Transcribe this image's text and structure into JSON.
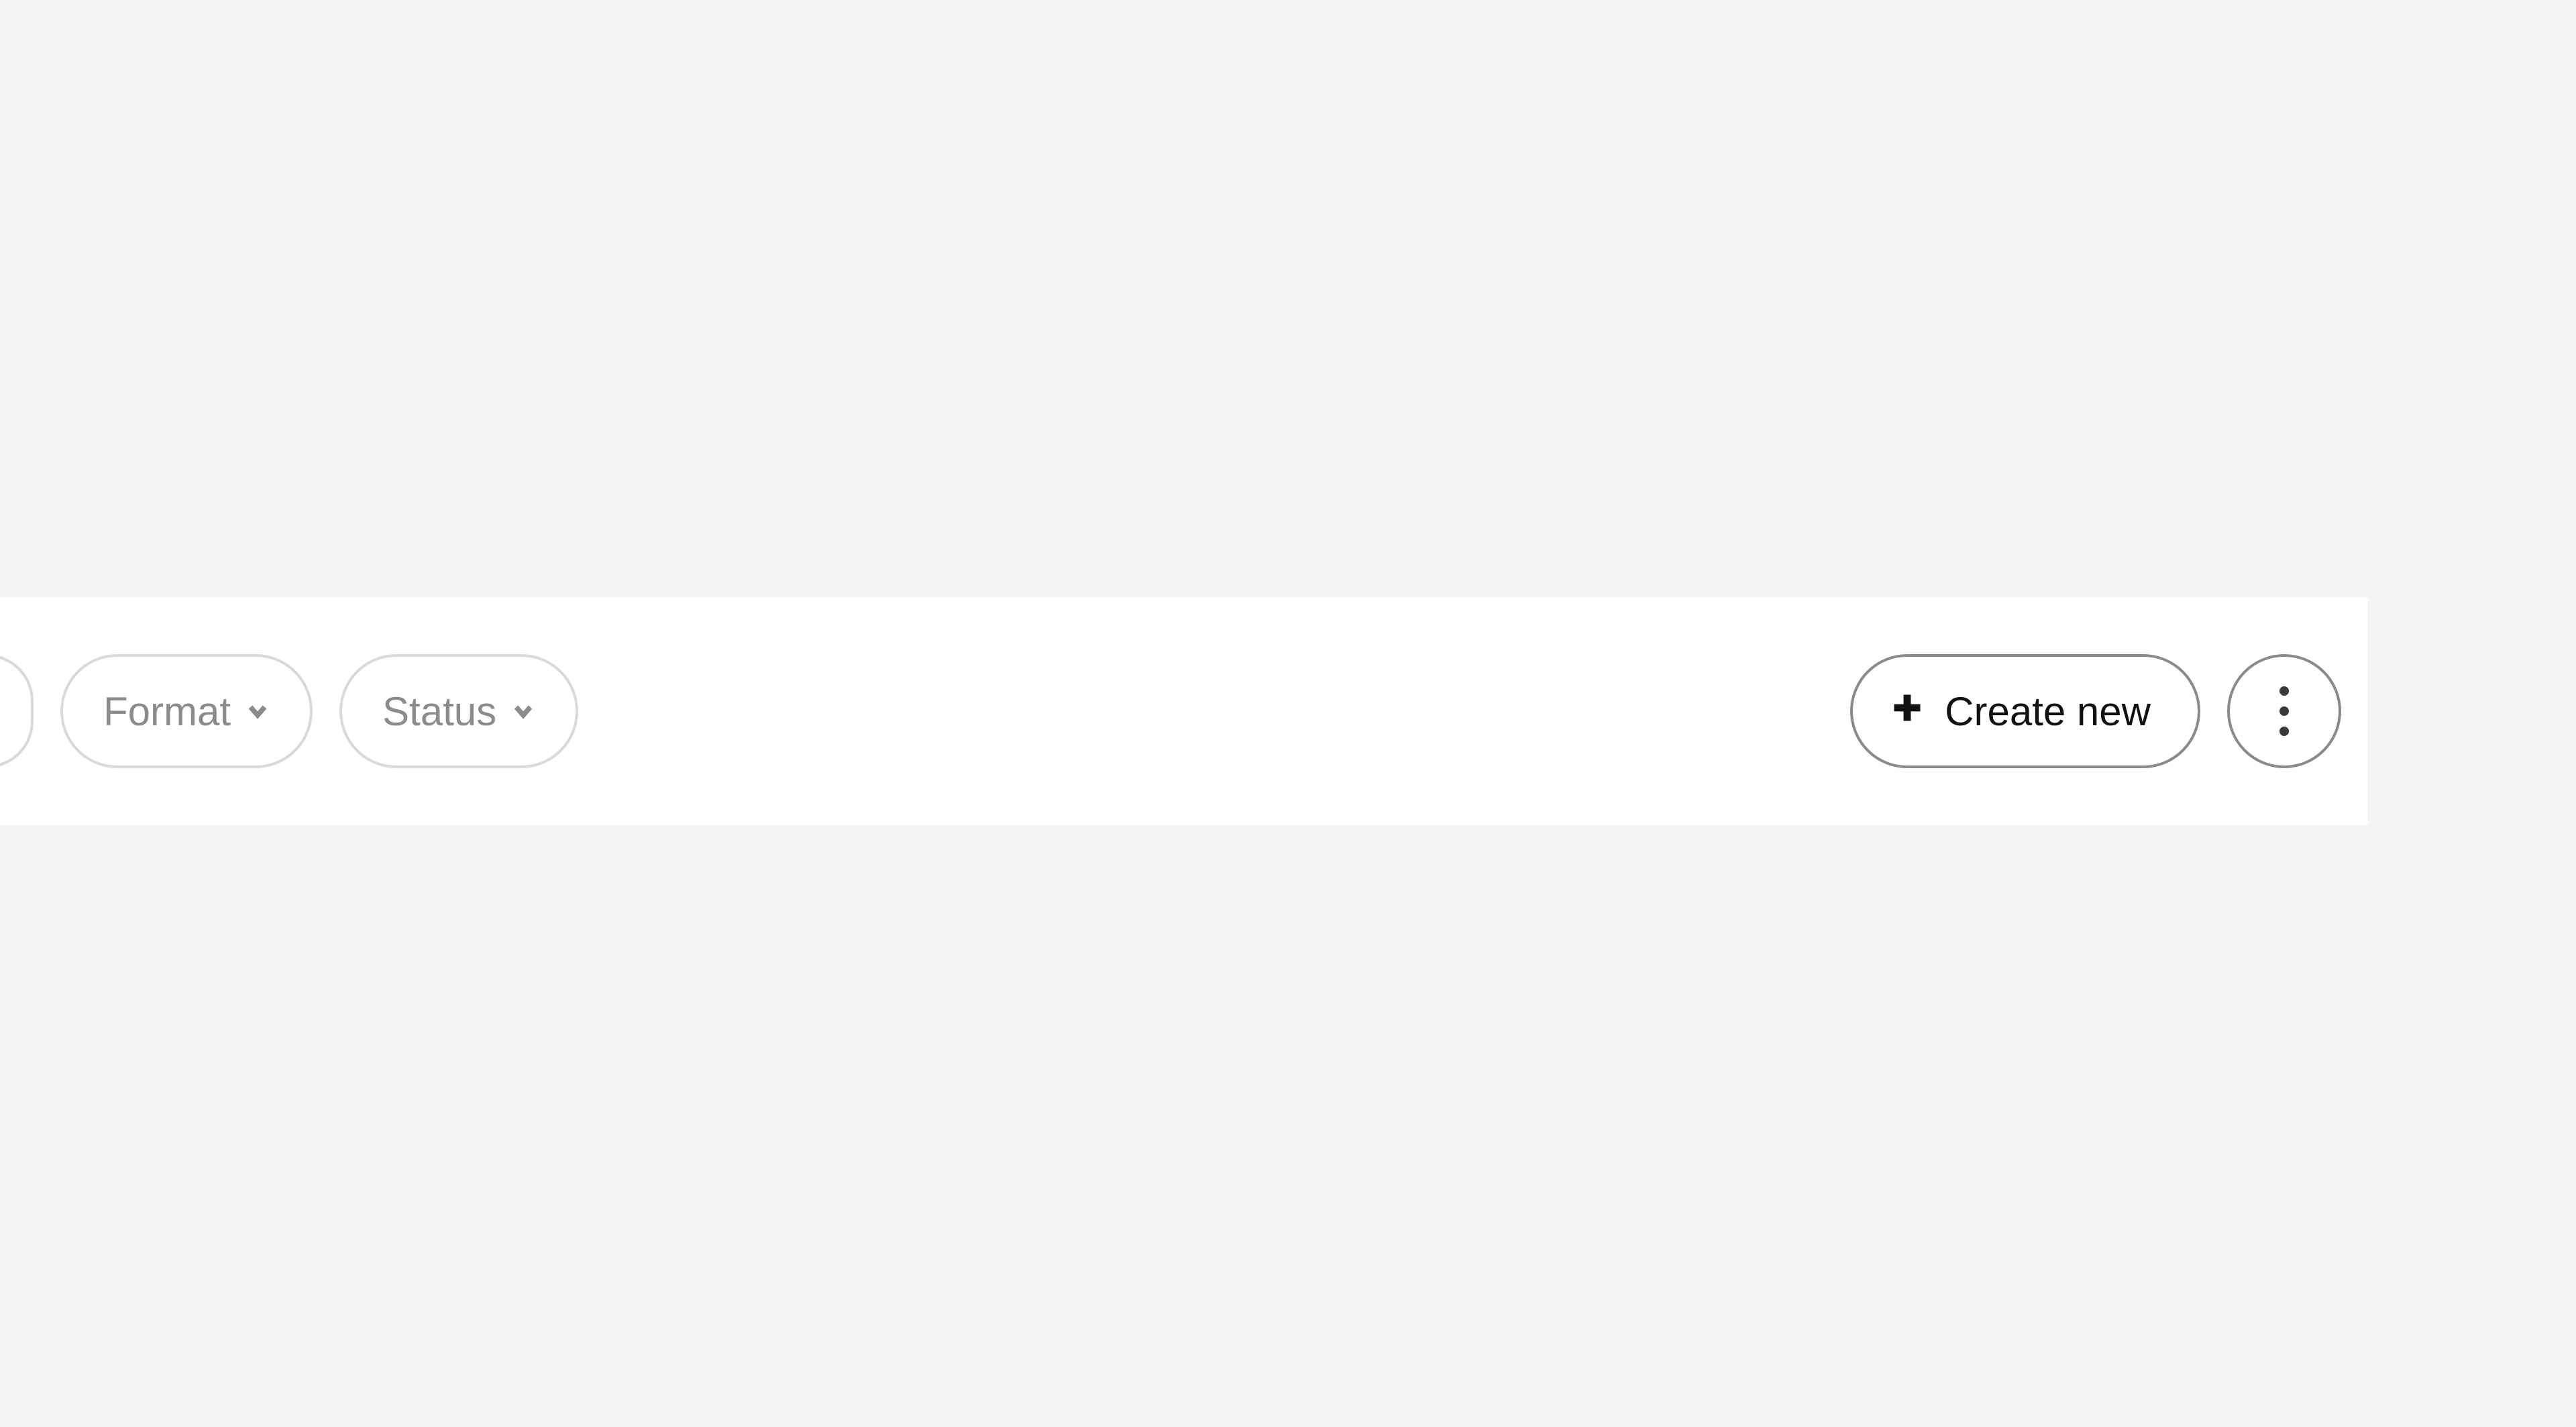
{
  "toolbar": {
    "filters": [
      {
        "label": "Format"
      },
      {
        "label": "Status"
      }
    ],
    "create_label": "Create new"
  }
}
